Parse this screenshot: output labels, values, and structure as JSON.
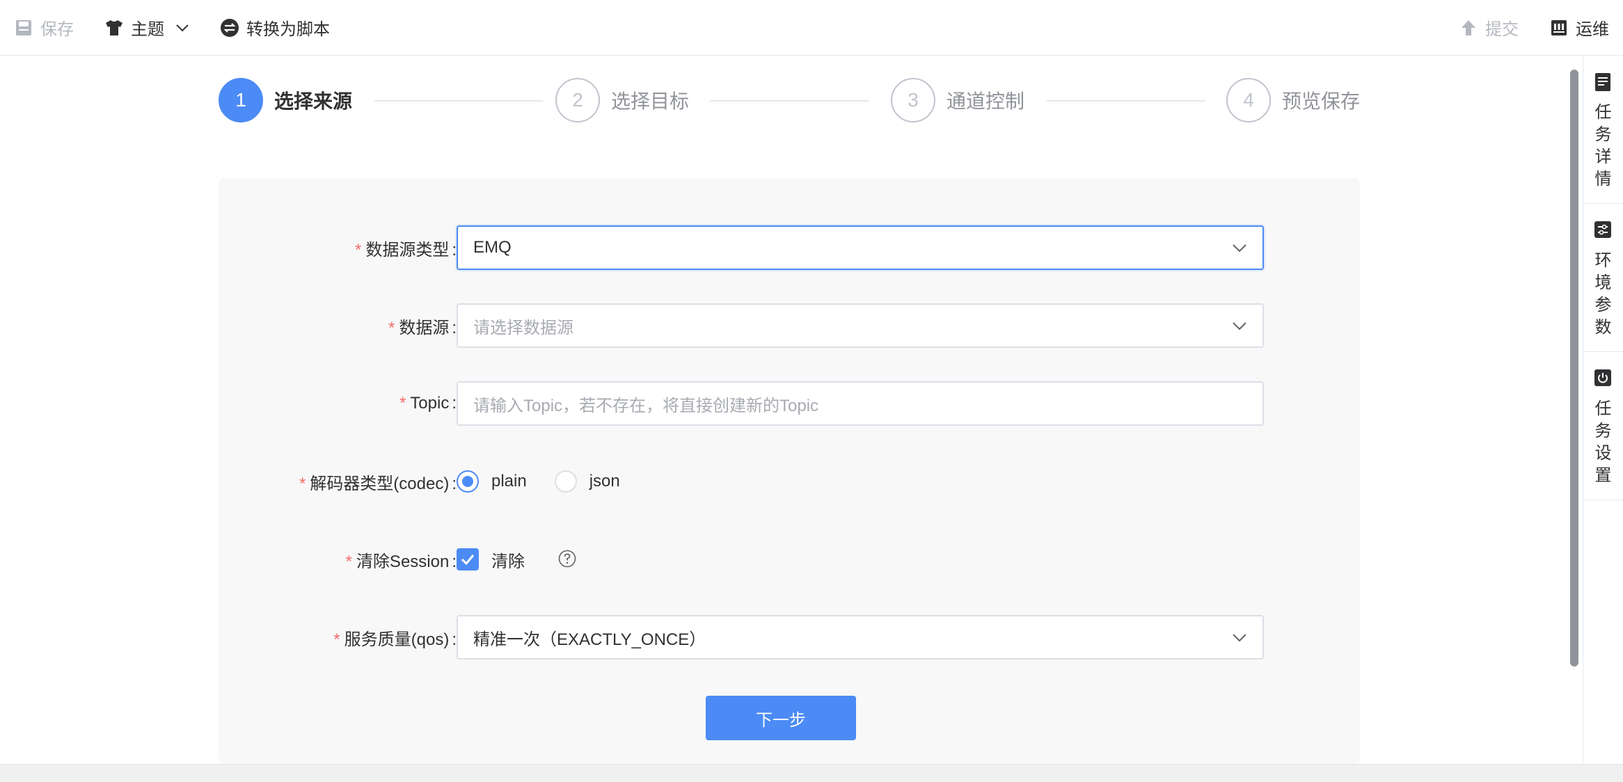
{
  "toolbar": {
    "save_label": "保存",
    "theme_label": "主题",
    "convert_label": "转换为脚本",
    "submit_label": "提交",
    "ops_label": "运维"
  },
  "steps": [
    {
      "number": "1",
      "title": "选择来源"
    },
    {
      "number": "2",
      "title": "选择目标"
    },
    {
      "number": "3",
      "title": "通道控制"
    },
    {
      "number": "4",
      "title": "预览保存"
    }
  ],
  "active_step": 1,
  "form": {
    "source_type": {
      "label": "数据源类型",
      "value": "EMQ"
    },
    "datasource": {
      "label": "数据源",
      "placeholder": "请选择数据源"
    },
    "topic": {
      "label": "Topic",
      "placeholder": "请输入Topic，若不存在，将直接创建新的Topic"
    },
    "codec": {
      "label": "解码器类型(codec)",
      "options": [
        "plain",
        "json"
      ],
      "selected": "plain"
    },
    "clean_session": {
      "label": "清除Session",
      "checkbox_label": "清除",
      "checked": true
    },
    "qos": {
      "label": "服务质量(qos)",
      "value": "精准一次（EXACTLY_ONCE）"
    },
    "required_mark": "*",
    "colon": ":"
  },
  "next_button_label": "下一步",
  "right_panel": [
    {
      "label": "任务详情",
      "icon": "document-icon"
    },
    {
      "label": "环境参数",
      "icon": "params-icon"
    },
    {
      "label": "任务设置",
      "icon": "power-icon"
    }
  ],
  "colors": {
    "primary": "#4c8bf5",
    "required": "#f56c6c",
    "card_bg": "#f8f8f8"
  }
}
